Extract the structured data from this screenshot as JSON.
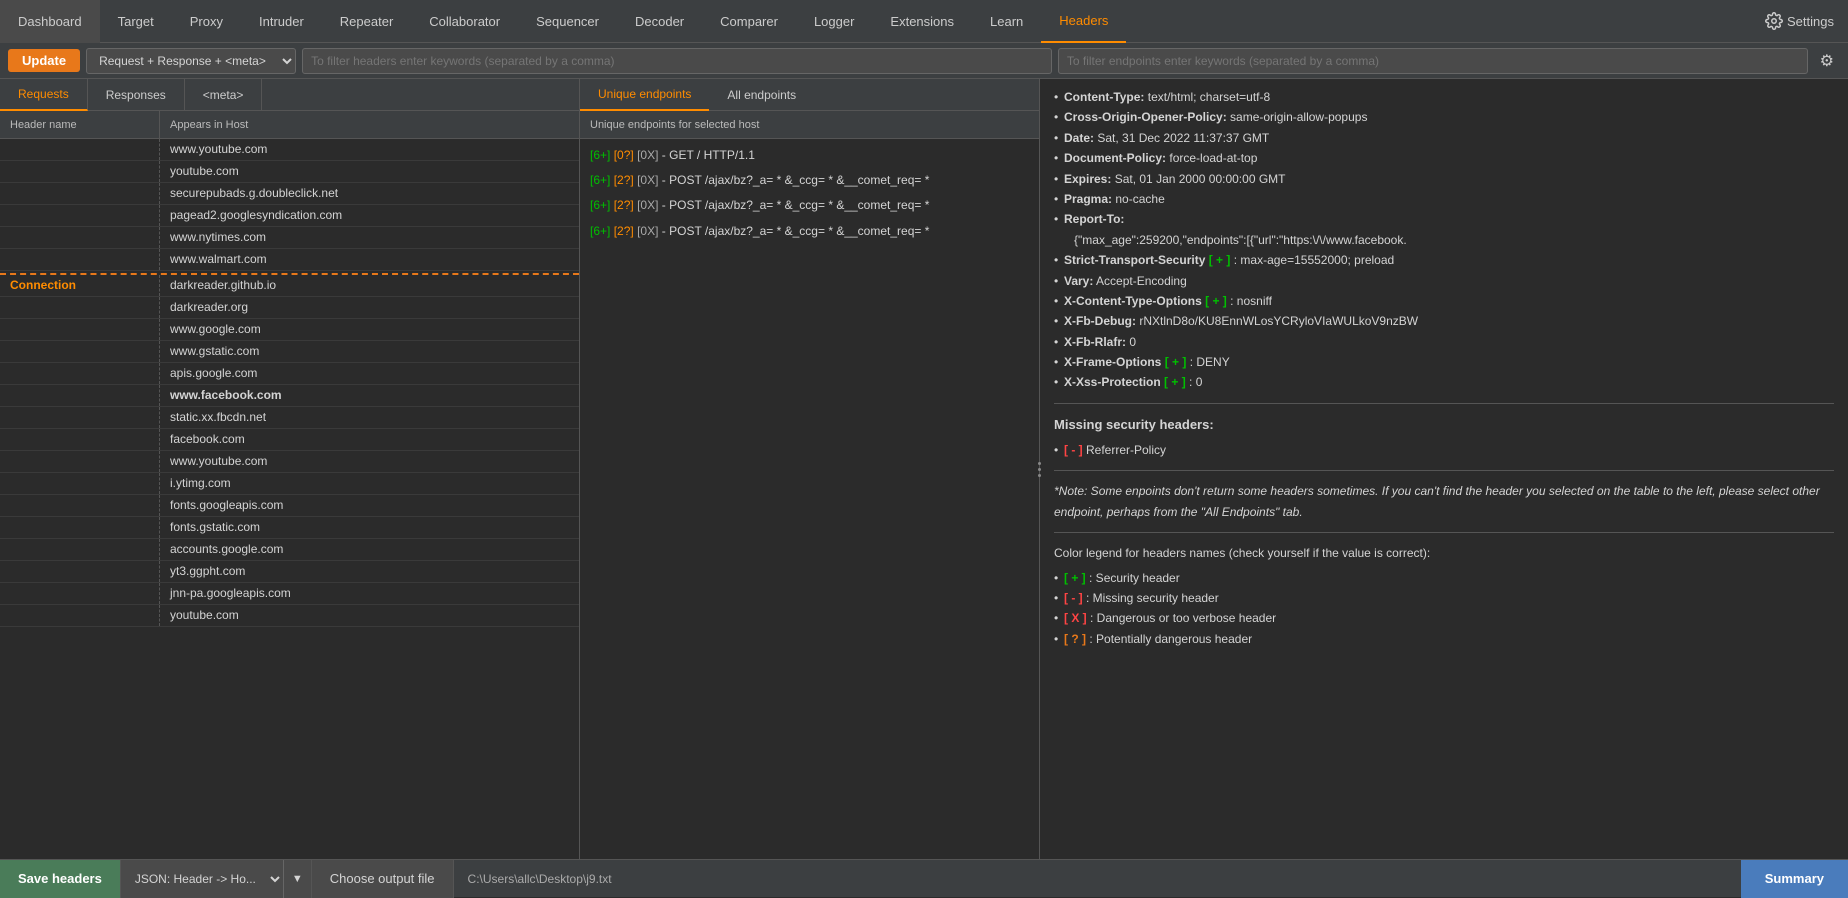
{
  "nav": {
    "items": [
      {
        "label": "Dashboard",
        "active": false
      },
      {
        "label": "Target",
        "active": false
      },
      {
        "label": "Proxy",
        "active": false
      },
      {
        "label": "Intruder",
        "active": false
      },
      {
        "label": "Repeater",
        "active": false
      },
      {
        "label": "Collaborator",
        "active": false
      },
      {
        "label": "Sequencer",
        "active": false
      },
      {
        "label": "Decoder",
        "active": false
      },
      {
        "label": "Comparer",
        "active": false
      },
      {
        "label": "Logger",
        "active": false
      },
      {
        "label": "Extensions",
        "active": false
      },
      {
        "label": "Learn",
        "active": false
      },
      {
        "label": "Headers",
        "active": true
      }
    ],
    "settings_label": "Settings"
  },
  "toolbar": {
    "update_label": "Update",
    "scope_value": "Request + Response + <meta>",
    "filter_headers_placeholder": "To filter headers enter keywords (separated by a comma)",
    "filter_endpoints_placeholder": "To filter endpoints enter keywords (separated by a comma)"
  },
  "sub_tabs": [
    {
      "label": "Requests",
      "active": true
    },
    {
      "label": "Responses",
      "active": false
    },
    {
      "label": "<meta>",
      "active": false
    }
  ],
  "table": {
    "col_name": "Header name",
    "col_host": "Appears in Host",
    "rows_before_sep": [
      {
        "name": "",
        "host": "www.youtube.com"
      },
      {
        "name": "",
        "host": "youtube.com"
      },
      {
        "name": "",
        "host": "securepubads.g.doubleclick.net"
      },
      {
        "name": "",
        "host": "pagead2.googlesyndication.com"
      },
      {
        "name": "",
        "host": "www.nytimes.com"
      },
      {
        "name": "",
        "host": "www.walmart.com"
      }
    ],
    "connection_section_label": "Connection",
    "rows_after_sep": [
      {
        "host": "darkreader.github.io"
      },
      {
        "host": "darkreader.org"
      },
      {
        "host": "www.google.com"
      },
      {
        "host": "www.gstatic.com"
      },
      {
        "host": "apis.google.com"
      },
      {
        "host": "www.facebook.com",
        "bold": true
      },
      {
        "host": "static.xx.fbcdn.net"
      },
      {
        "host": "facebook.com"
      },
      {
        "host": "www.youtube.com"
      },
      {
        "host": "i.ytimg.com"
      },
      {
        "host": "fonts.googleapis.com"
      },
      {
        "host": "fonts.gstatic.com"
      },
      {
        "host": "accounts.google.com"
      },
      {
        "host": "yt3.ggpht.com"
      },
      {
        "host": "jnn-pa.googleapis.com"
      },
      {
        "host": "youtube.com"
      }
    ]
  },
  "endpoint_tabs": [
    {
      "label": "Unique endpoints",
      "active": true
    },
    {
      "label": "All endpoints",
      "active": false
    }
  ],
  "endpoint_header": "Unique endpoints for selected host",
  "endpoints": [
    {
      "badge1": "[6+]",
      "badge2": "[0?]",
      "badge3": "[0X]",
      "method": "GET / HTTP/1.1"
    },
    {
      "badge1": "[6+]",
      "badge2": "[2?]",
      "badge3": "[0X]",
      "method": "POST /ajax/bz?_a= * &_ccg= * &__comet_req= *"
    },
    {
      "badge1": "[6+]",
      "badge2": "[2?]",
      "badge3": "[0X]",
      "method": "POST /ajax/bz?_a= * &_ccg= * &__comet_req= *"
    },
    {
      "badge1": "[6+]",
      "badge2": "[2?]",
      "badge3": "[0X]",
      "method": "POST /ajax/bz?_a= * &_ccg= * &__comet_req= *"
    }
  ],
  "right_panel": {
    "headers": [
      {
        "key": "Content-Type:",
        "val": "text/html; charset=utf-8",
        "tag": null
      },
      {
        "key": "Cross-Origin-Opener-Policy:",
        "val": "same-origin-allow-popups",
        "tag": null
      },
      {
        "key": "Date:",
        "val": "Sat, 31 Dec 2022 11:37:37 GMT",
        "tag": null
      },
      {
        "key": "Document-Policy:",
        "val": "force-load-at-top",
        "tag": null
      },
      {
        "key": "Expires:",
        "val": "Sat, 01 Jan 2000 00:00:00 GMT",
        "tag": null
      },
      {
        "key": "Pragma:",
        "val": "no-cache",
        "tag": null
      },
      {
        "key": "Report-To:",
        "val": "{\"max_age\":259200,\"endpoints\":[{\"url\":\"https:\\/\\/www.facebook.",
        "tag": null
      },
      {
        "key": "Strict-Transport-Security",
        "val": ": max-age=15552000; preload",
        "tag": "plus"
      },
      {
        "key": "Vary:",
        "val": "Accept-Encoding",
        "tag": null
      },
      {
        "key": "X-Content-Type-Options",
        "val": ": nosniff",
        "tag": "plus"
      },
      {
        "key": "X-Fb-Debug:",
        "val": "rNXtlnD8o/KU8EnnWLosYCRyloVIaWULkoV9nzBW",
        "tag": null
      },
      {
        "key": "X-Fb-Rlafr:",
        "val": "0",
        "tag": null
      },
      {
        "key": "X-Frame-Options",
        "val": ": DENY",
        "tag": "plus"
      },
      {
        "key": "X-Xss-Protection",
        "val": ": 0",
        "tag": "plus"
      }
    ],
    "missing_title": "Missing security headers:",
    "missing_items": [
      {
        "tag": "minus",
        "label": "Referrer-Policy"
      }
    ],
    "note": "*Note: Some enpoints don't return some headers sometimes. If you can't find the header you selected on the table to the left, please select other endpoint, perhaps from the \"All Endpoints\" tab.",
    "legend_title": "Color legend for headers names (check yourself if the value is correct):",
    "legend": [
      {
        "tag": "plus",
        "text": ": Security header"
      },
      {
        "tag": "minus",
        "text": ": Missing security header"
      },
      {
        "tag": "x",
        "text": ": Dangerous or too verbose header"
      },
      {
        "tag": "q",
        "text": ": Potentially dangerous header"
      }
    ]
  },
  "bottom_bar": {
    "save_label": "Save headers",
    "format_label": "JSON: Header -> Ho...",
    "choose_file_label": "Choose output file",
    "file_path": "C:\\Users\\allc\\Desktop\\j9.txt",
    "summary_label": "Summary"
  }
}
